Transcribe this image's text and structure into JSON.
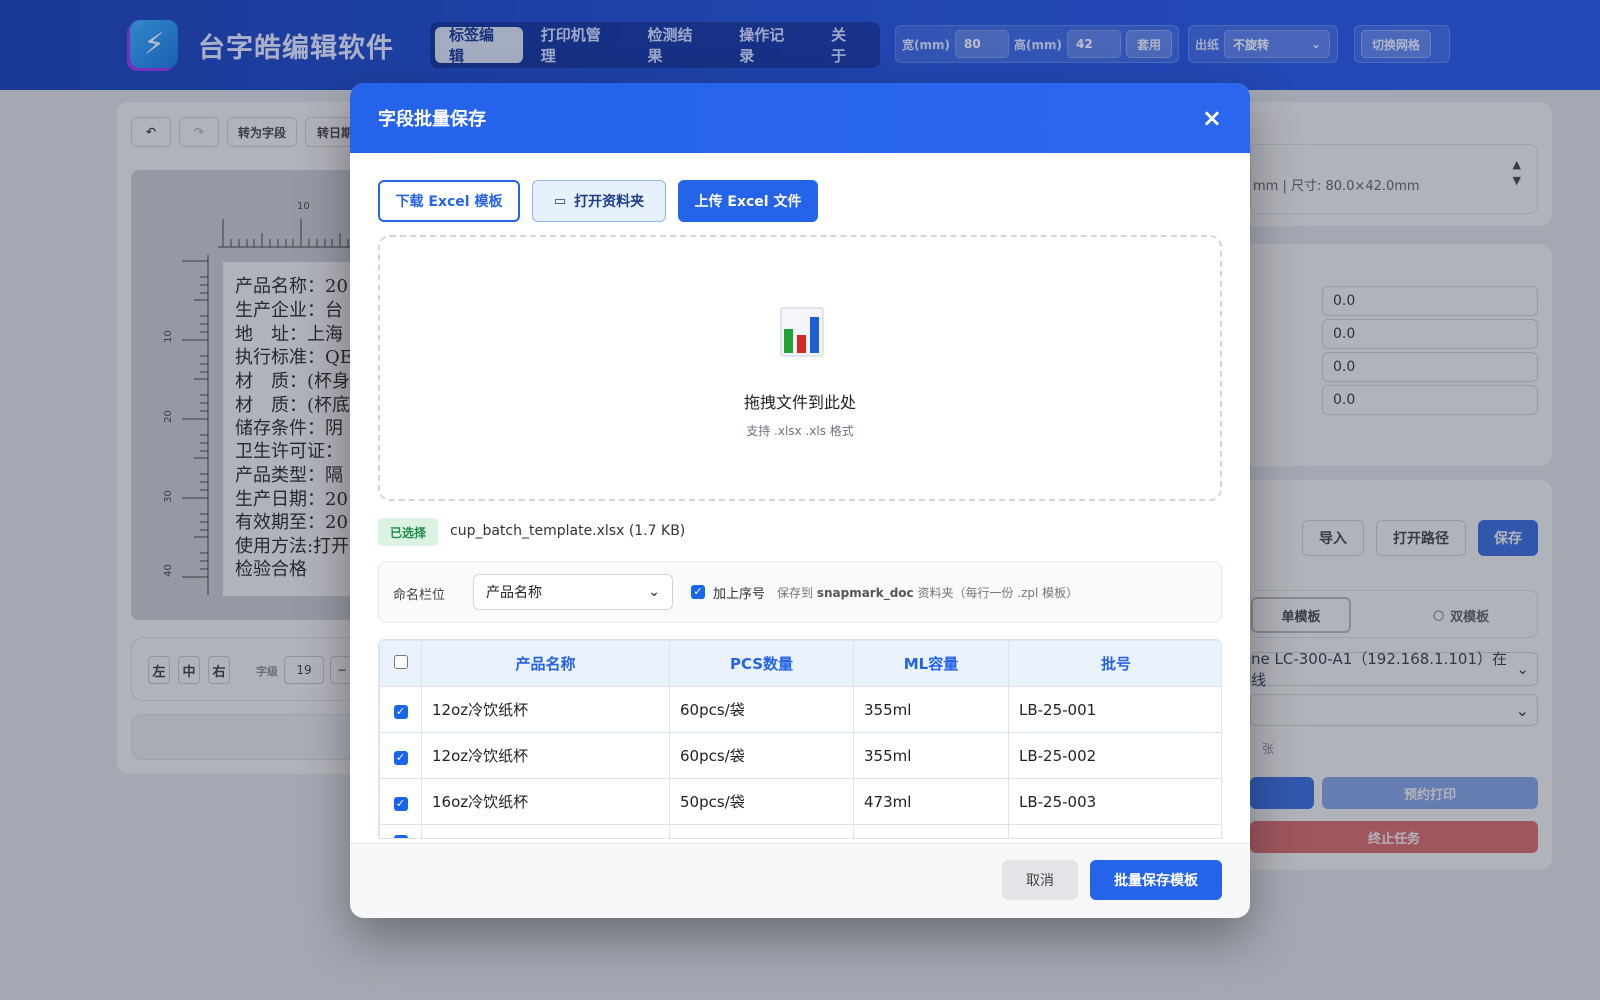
{
  "app": {
    "title": "台字皓编辑软件"
  },
  "nav": {
    "tabs": [
      "标签编辑",
      "打印机管理",
      "检测结果",
      "操作记录",
      "关于"
    ]
  },
  "size_bar": {
    "width_label": "宽(mm)",
    "width_value": "80",
    "height_label": "高(mm)",
    "height_value": "42",
    "apply_label": "套用"
  },
  "output_bar": {
    "label": "出纸",
    "value": "不旋转"
  },
  "grid_toggle": {
    "label": "切换网格"
  },
  "editor": {
    "to_field": "转为字段",
    "to_date": "转日期",
    "ruler_top": "10",
    "ruler_left": [
      "10",
      "20",
      "30",
      "40"
    ],
    "label_lines": [
      "产品名称：20",
      "生产企业：台",
      "地　址：上海",
      "执行标准：QE",
      "材　质：(杯身",
      "材　质：(杯底",
      "储存条件：阴",
      "卫生许可证：",
      "产品类型：隔",
      "生产日期：20",
      "有效期至：20",
      "使用方法:打开",
      "检验合格"
    ],
    "align": [
      "左",
      "中",
      "右"
    ],
    "font_label": "字级",
    "font_value": "19"
  },
  "right_panel": {
    "info": "mm | 尺寸: 80.0×42.0mm",
    "fields": [
      "0.0",
      "0.0",
      "0.0",
      "0.0"
    ],
    "import": "导入",
    "open_path": "打开路径",
    "save": "保存",
    "single": "单模板",
    "double": "双模板",
    "printer": "ne LC-300-A1（192.168.1.101）在线",
    "sheets": "张",
    "schedule": "预约打印",
    "stop": "终止任务"
  },
  "modal": {
    "title": "字段批量保存",
    "close": "×",
    "download_btn": "下载 Excel 模板",
    "open_folder_btn": "打开资料夹",
    "upload_btn": "上传 Excel 文件",
    "drop_title": "拖拽文件到此处",
    "drop_sub": "支持 .xlsx .xls 格式",
    "selected_badge": "已选择",
    "file_name": "cup_batch_template.xlsx (1.7 KB)",
    "naming_label": "命名栏位",
    "naming_value": "产品名称",
    "seq_label": "加上序号",
    "hint_prefix": "保存到 ",
    "hint_folder": "snapmark_doc",
    "hint_suffix": " 资料夹（每行一份 .zpl 模板）",
    "columns": [
      "产品名称",
      "PCS数量",
      "ML容量",
      "批号"
    ],
    "rows": [
      [
        "12oz冷饮纸杯",
        "60pcs/袋",
        "355ml",
        "LB-25-001"
      ],
      [
        "12oz冷饮纸杯",
        "60pcs/袋",
        "355ml",
        "LB-25-002"
      ],
      [
        "16oz冷饮纸杯",
        "50pcs/袋",
        "473ml",
        "LB-25-003"
      ]
    ],
    "cancel": "取消",
    "save": "批量保存模板"
  }
}
